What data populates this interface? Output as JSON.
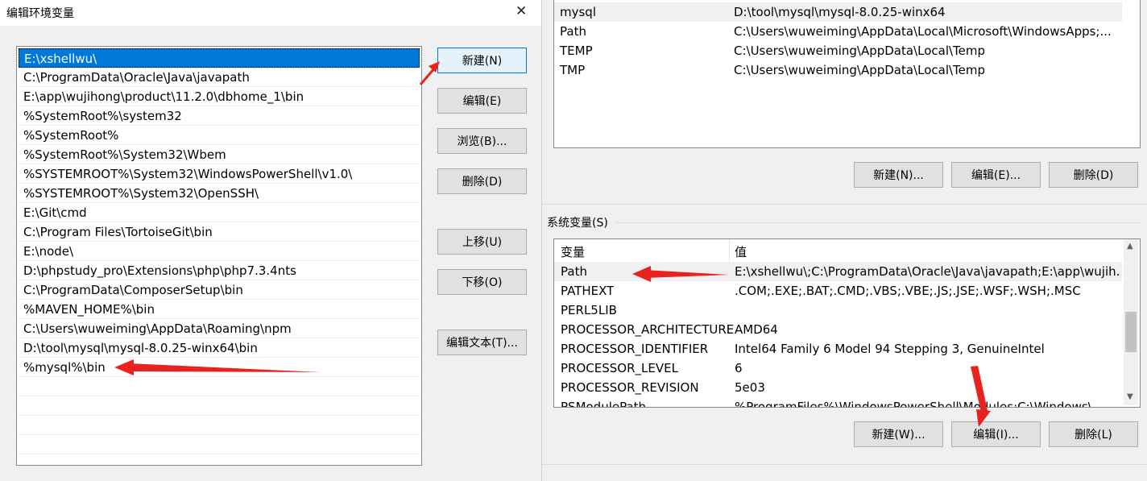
{
  "dialog": {
    "title": "编辑环境变量",
    "close_glyph": "✕",
    "path_entries": [
      "E:\\xshellwu\\",
      "C:\\ProgramData\\Oracle\\Java\\javapath",
      "E:\\app\\wujihong\\product\\11.2.0\\dbhome_1\\bin",
      "%SystemRoot%\\system32",
      "%SystemRoot%",
      "%SystemRoot%\\System32\\Wbem",
      "%SYSTEMROOT%\\System32\\WindowsPowerShell\\v1.0\\",
      "%SYSTEMROOT%\\System32\\OpenSSH\\",
      "E:\\Git\\cmd",
      "C:\\Program Files\\TortoiseGit\\bin",
      "E:\\node\\",
      "D:\\phpstudy_pro\\Extensions\\php\\php7.3.4nts",
      "C:\\ProgramData\\ComposerSetup\\bin",
      "%MAVEN_HOME%\\bin",
      "C:\\Users\\wuweiming\\AppData\\Roaming\\npm",
      "D:\\tool\\mysql\\mysql-8.0.25-winx64\\bin",
      "%mysql%\\bin"
    ],
    "buttons": {
      "new": "新建(N)",
      "edit": "编辑(E)",
      "browse": "浏览(B)...",
      "delete": "删除(D)",
      "move_up": "上移(U)",
      "move_down": "下移(O)",
      "edit_text": "编辑文本(T)..."
    }
  },
  "user_vars": {
    "rows": [
      {
        "name": "mysql",
        "value": "D:\\tool\\mysql\\mysql-8.0.25-winx64"
      },
      {
        "name": "Path",
        "value": "C:\\Users\\wuweiming\\AppData\\Local\\Microsoft\\WindowsApps;..."
      },
      {
        "name": "TEMP",
        "value": "C:\\Users\\wuweiming\\AppData\\Local\\Temp"
      },
      {
        "name": "TMP",
        "value": "C:\\Users\\wuweiming\\AppData\\Local\\Temp"
      }
    ],
    "buttons": {
      "new": "新建(N)...",
      "edit": "编辑(E)...",
      "delete": "删除(D)"
    }
  },
  "system_vars": {
    "section_label": "系统变量(S)",
    "col_name": "变量",
    "col_value": "值",
    "rows": [
      {
        "name": "Path",
        "value": "E:\\xshellwu\\;C:\\ProgramData\\Oracle\\Java\\javapath;E:\\app\\wujih..."
      },
      {
        "name": "PATHEXT",
        "value": ".COM;.EXE;.BAT;.CMD;.VBS;.VBE;.JS;.JSE;.WSF;.WSH;.MSC"
      },
      {
        "name": "PERL5LIB",
        "value": ""
      },
      {
        "name": "PROCESSOR_ARCHITECTURE",
        "value": "AMD64"
      },
      {
        "name": "PROCESSOR_IDENTIFIER",
        "value": "Intel64 Family 6 Model 94 Stepping 3, GenuineIntel"
      },
      {
        "name": "PROCESSOR_LEVEL",
        "value": "6"
      },
      {
        "name": "PROCESSOR_REVISION",
        "value": "5e03"
      },
      {
        "name": "PSModulePath",
        "value": "%ProgramFiles%\\WindowsPowerShell\\Modules;C:\\Windows\\..."
      }
    ],
    "buttons": {
      "new": "新建(W)...",
      "edit": "编辑(I)...",
      "delete": "删除(L)"
    }
  },
  "colors": {
    "selection": "#0078d7",
    "annotation_arrow": "#e8231f"
  }
}
